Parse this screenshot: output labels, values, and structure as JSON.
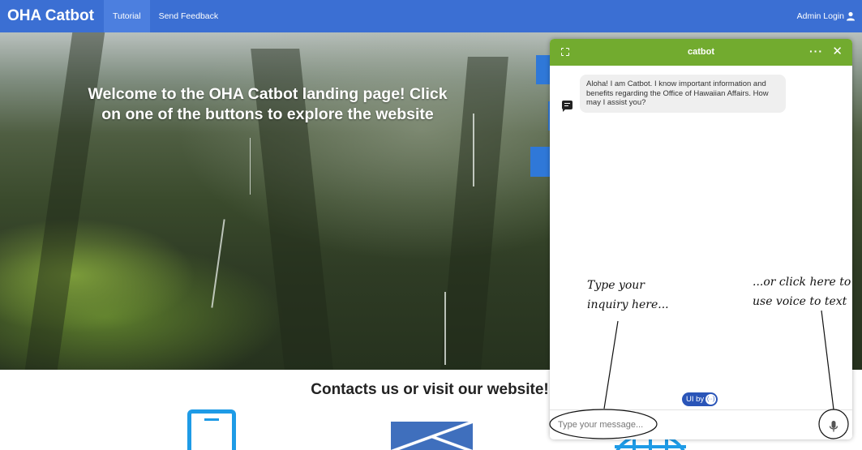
{
  "navbar": {
    "brand": "OHA Catbot",
    "links": [
      "Tutorial",
      "Send Feedback"
    ],
    "admin_label": "Admin Login"
  },
  "hero": {
    "title": "Welcome to the OHA Catbot landing page! Click on one of the buttons to explore the website"
  },
  "contacts": {
    "title": "Contacts us or visit our website!"
  },
  "chat": {
    "title": "catbot",
    "more_label": "···",
    "close_label": "✕",
    "bot_message": "Aloha! I am Catbot. I know important information and benefits regarding the Office of Hawaiian Affairs. How may I assist you?",
    "ui_by_label": "UI by",
    "ui_by_mark": "(··)",
    "input_placeholder": "Type your message..."
  },
  "annotations": {
    "type_hint_line1": "Type your",
    "type_hint_line2": "inquiry here...",
    "voice_hint_line1": "...or click here to",
    "voice_hint_line2": "use voice to text"
  },
  "colors": {
    "navbar": "#3b6fd3",
    "chat_header": "#72ab2f",
    "accent_blue": "#1e9be6"
  }
}
